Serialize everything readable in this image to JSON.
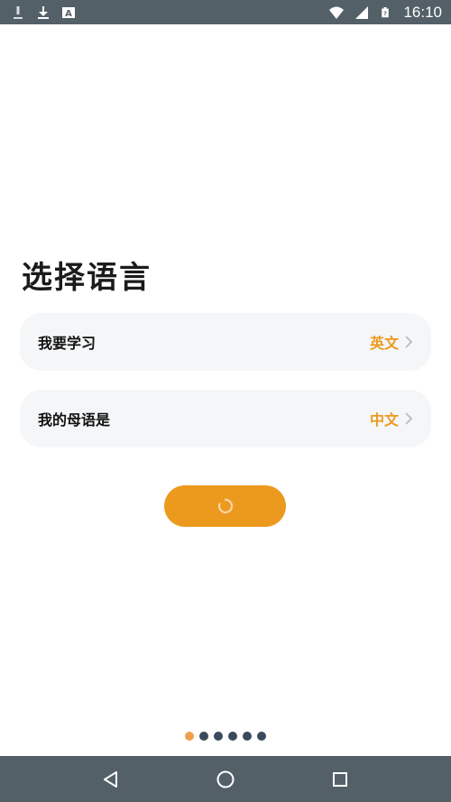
{
  "status_bar": {
    "time": "16:10",
    "left_icons": [
      "notification-icon",
      "download-icon",
      "keyboard-a-icon"
    ],
    "right_icons": [
      "wifi-icon",
      "signal-icon",
      "battery-icon"
    ]
  },
  "page": {
    "title": "选择语言"
  },
  "options": [
    {
      "label": "我要学习",
      "value": "英文"
    },
    {
      "label": "我的母语是",
      "value": "中文"
    }
  ],
  "next_button": {
    "state": "loading"
  },
  "pager": {
    "count": 6,
    "active_index": 0
  },
  "colors": {
    "accent": "#ec9a1e",
    "status_bar_bg": "#546068",
    "row_bg": "#f4f6f8",
    "dot_inactive": "#3a4a5a",
    "dot_active": "#f0a04a"
  },
  "nav_bar": {
    "buttons": [
      "back-icon",
      "home-icon",
      "recents-icon"
    ]
  }
}
